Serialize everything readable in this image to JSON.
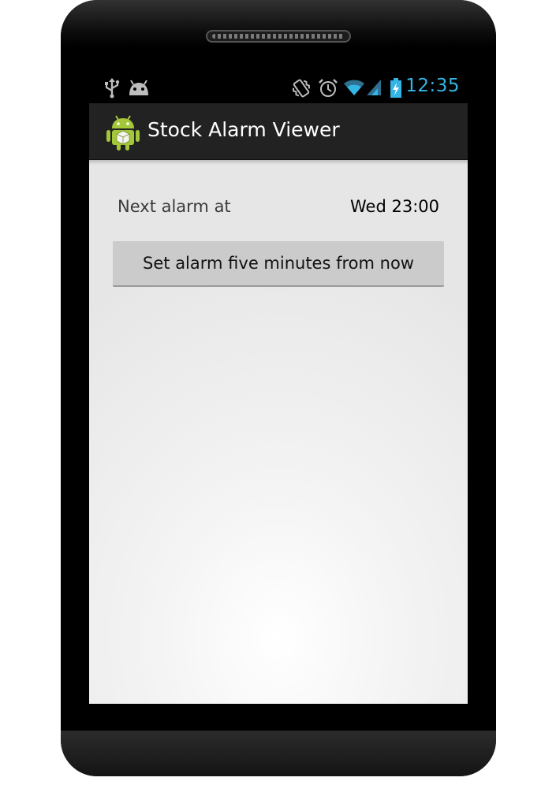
{
  "status_bar": {
    "time": "12:35",
    "icons": [
      "usb-icon",
      "android-debug-icon",
      "vibrate-icon",
      "alarm-clock-icon",
      "wifi-icon",
      "cell-signal-icon",
      "battery-charging-icon"
    ],
    "time_color": "#33b5e5"
  },
  "action_bar": {
    "icon": "android-app-icon",
    "title": "Stock Alarm Viewer"
  },
  "main": {
    "alarm_label": "Next alarm at",
    "alarm_value": "Wed 23:00",
    "set_button_label": "Set alarm five minutes from now"
  },
  "colors": {
    "action_bar": "#222222",
    "content_bg": "#e8e8e8",
    "button_bg": "#cbcbcb",
    "accent": "#33b5e5",
    "android_green": "#a4c639"
  }
}
